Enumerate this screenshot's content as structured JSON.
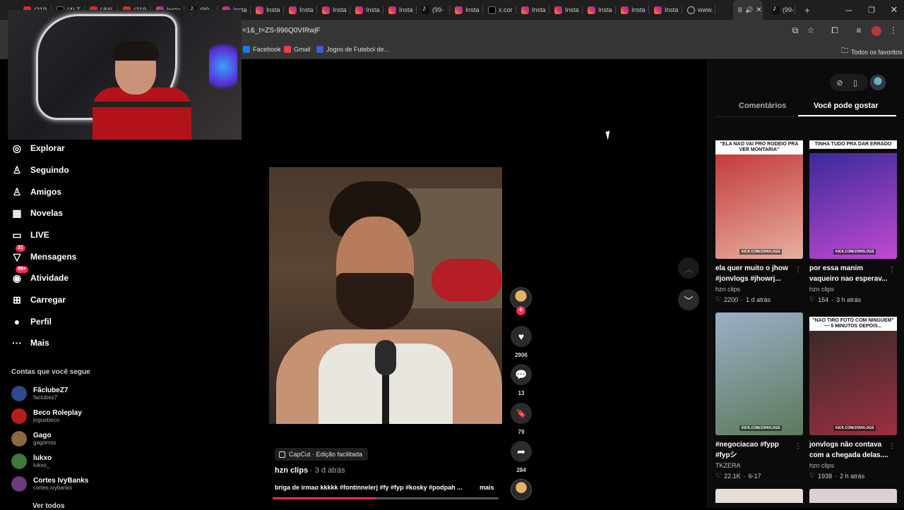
{
  "browser": {
    "tabs": [
      {
        "icon": "yt",
        "label": "(219"
      },
      {
        "icon": "x",
        "label": "(4) T"
      },
      {
        "icon": "yt",
        "label": "UM/"
      },
      {
        "icon": "yt",
        "label": "(219"
      },
      {
        "icon": "ig",
        "label": "Insta"
      },
      {
        "icon": "tt",
        "label": "(99"
      },
      {
        "icon": "ig",
        "label": "Insta"
      },
      {
        "icon": "ig",
        "label": "Insta"
      },
      {
        "icon": "ig",
        "label": "Insta"
      },
      {
        "icon": "ig",
        "label": "Insta"
      },
      {
        "icon": "ig",
        "label": "Insta"
      },
      {
        "icon": "ig",
        "label": "Insta"
      },
      {
        "icon": "tt",
        "label": "(99-"
      },
      {
        "icon": "ig",
        "label": "Insta"
      },
      {
        "icon": "x",
        "label": "x.cor"
      },
      {
        "icon": "ig",
        "label": "Insta"
      },
      {
        "icon": "ig",
        "label": "Insta"
      },
      {
        "icon": "ig",
        "label": "Insta"
      },
      {
        "icon": "ig",
        "label": "Insta"
      },
      {
        "icon": "ig",
        "label": "Insta"
      },
      {
        "icon": "globe",
        "label": "www."
      }
    ],
    "active_tab_label": "B",
    "last_tab_label": "(99-",
    "new_tab": "+",
    "url": "=1&_t=ZS-996Q0VIRwjF",
    "bookmarks": [
      {
        "label": "Facebook",
        "color": "#1877f2"
      },
      {
        "label": "Gmail",
        "color": "#ea4335"
      },
      {
        "label": "Jogos de Futebol de...",
        "color": "#3b5bdb"
      }
    ],
    "all_bookmarks": "Todos os favoritos"
  },
  "nav": {
    "items": [
      {
        "icon": "compass-icon",
        "glyph": "◎",
        "label": "Explorar"
      },
      {
        "icon": "following-icon",
        "glyph": "♙",
        "label": "Seguindo"
      },
      {
        "icon": "friends-icon",
        "glyph": "♙",
        "label": "Amigos"
      },
      {
        "icon": "novelas-icon",
        "glyph": "▦",
        "label": "Novelas"
      },
      {
        "icon": "live-icon",
        "glyph": "▭",
        "label": "LIVE"
      },
      {
        "icon": "messages-icon",
        "glyph": "▽",
        "label": "Mensagens",
        "badge": "31"
      },
      {
        "icon": "activity-icon",
        "glyph": "◉",
        "label": "Atividade",
        "badge": "99+"
      },
      {
        "icon": "upload-icon",
        "glyph": "⊞",
        "label": "Carregar"
      },
      {
        "icon": "profile-icon",
        "glyph": "●",
        "label": "Perfil"
      },
      {
        "icon": "more-icon",
        "glyph": "···",
        "label": "Mais"
      }
    ],
    "following_title": "Contas que você segue",
    "accounts": [
      {
        "name": "FãclubeZ7",
        "handle": "faclubez7",
        "color": "#2d4a8a"
      },
      {
        "name": "Beco Roleplay",
        "handle": "joguebeco",
        "color": "#b3201c"
      },
      {
        "name": "Gago",
        "handle": "gagomss",
        "color": "#8a6a3a"
      },
      {
        "name": "lukxo",
        "handle": "lukxo_",
        "color": "#3a7a3a"
      },
      {
        "name": "Cortes IvyBanks",
        "handle": "cortes.ivybanks",
        "color": "#6a3a7a"
      }
    ],
    "see_all": "Ver todos"
  },
  "video": {
    "capcut": "CapCut · Edição facilitada",
    "author": "hzn clips",
    "time": " · 3 d atrás",
    "description": "briga de irmao kkkkk #fontinnelerj #fy #fyp #kosky #podpah ...",
    "more": "mais",
    "progress": 0.46,
    "likes": "2906",
    "comments": "13",
    "saves": "79",
    "shares": "284"
  },
  "right_panel": {
    "tab_comments": "Comentários",
    "tab_suggested": "Você pode gostar",
    "cards": [
      {
        "caption": "\"ELA NAO VAI PRO RODEIO PRA VER MONTARIA\"",
        "title": "ela quer muito o jhow #jonvlogs #jhowrj...",
        "author": "hzn clips",
        "likes": "2200",
        "time": "1 d atrás",
        "colors": [
          "#c23a3a",
          "#e6b0a0"
        ]
      },
      {
        "caption": "TINHA TUDO PRA DAR ERRADO",
        "title": "por essa manim vaqueiro nao esperav...",
        "author": "hzn clips",
        "likes": "154",
        "time": "3 h atrás",
        "colors": [
          "#3a2a9a",
          "#c04ad0"
        ]
      },
      {
        "caption": "",
        "title": "#negociacao #fypp #fypシ",
        "author": "TKZERA",
        "likes": "22.1K",
        "time": "6-17",
        "colors": [
          "#9ab0c8",
          "#5a7a5a"
        ]
      },
      {
        "caption": "\"NAO TIRO FOTO COM NINGUEM\" — 5 MINUTOS DEPOIS...",
        "title": "jonvlogs não contava com a chegada delas....",
        "author": "hzn clips",
        "likes": "1938",
        "time": "2 h atrás",
        "colors": [
          "#3a2a2a",
          "#9a3040"
        ]
      }
    ],
    "kick_tag": "KICK.COM/JONVLOGS"
  }
}
